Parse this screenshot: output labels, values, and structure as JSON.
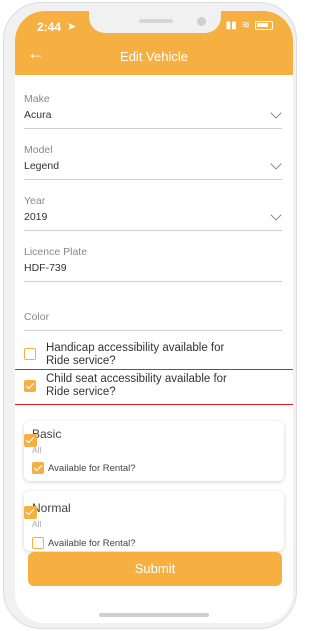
{
  "status_bar": {
    "time": "2:44",
    "location_icon": "location-arrow-icon",
    "wifi_icon": "wifi-icon",
    "battery_icon": "battery-icon"
  },
  "header": {
    "title": "Edit Vehicle",
    "back_icon": "back-arrow-icon"
  },
  "form": {
    "make": {
      "label": "Make",
      "value": "Acura"
    },
    "model": {
      "label": "Model",
      "value": "Legend"
    },
    "year": {
      "label": "Year",
      "value": "2019"
    },
    "plate": {
      "label": "Licence Plate",
      "value": "HDF-739"
    },
    "color": {
      "label": "Color",
      "value": ""
    }
  },
  "accessibility": {
    "handicap": {
      "label": "Handicap accessibility available for Ride service?",
      "checked": false
    },
    "child_seat": {
      "label": "Child seat accessibility available for Ride service?",
      "checked": true
    }
  },
  "services": [
    {
      "name": "Basic",
      "sub": "All",
      "checked": true,
      "rental_label": "Available for Rental?",
      "rental_checked": true
    },
    {
      "name": "Normal",
      "sub": "All",
      "checked": true,
      "rental_label": "Available for Rental?",
      "rental_checked": false
    }
  ],
  "submit_label": "Submit",
  "colors": {
    "accent": "#F6B042",
    "highlight": "#e02020"
  }
}
